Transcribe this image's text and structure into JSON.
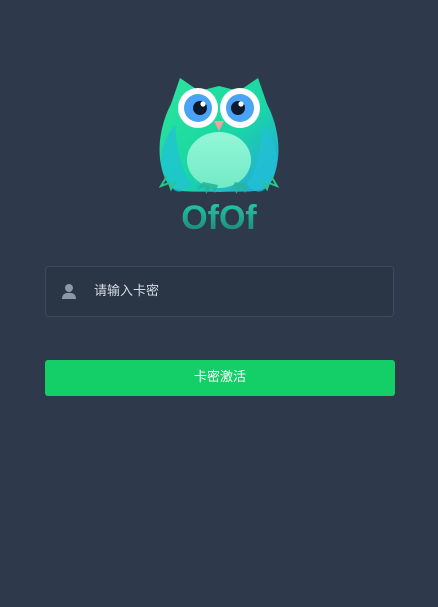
{
  "brand": {
    "logo_text": "OfOf",
    "icon_name": "owl-logo-icon",
    "accent": "#14cf68",
    "logo_gradient_start": "#1ee39c",
    "logo_gradient_end": "#2f9fe8"
  },
  "form": {
    "user_icon": "user-icon",
    "card_placeholder": "请输入卡密",
    "card_value": ""
  },
  "actions": {
    "activate_label": "卡密激活"
  },
  "theme": {
    "background": "#2e3a4b",
    "input_border": "#3c4a5d",
    "input_text": "#d5dbe3",
    "button_text": "#ffffff"
  }
}
